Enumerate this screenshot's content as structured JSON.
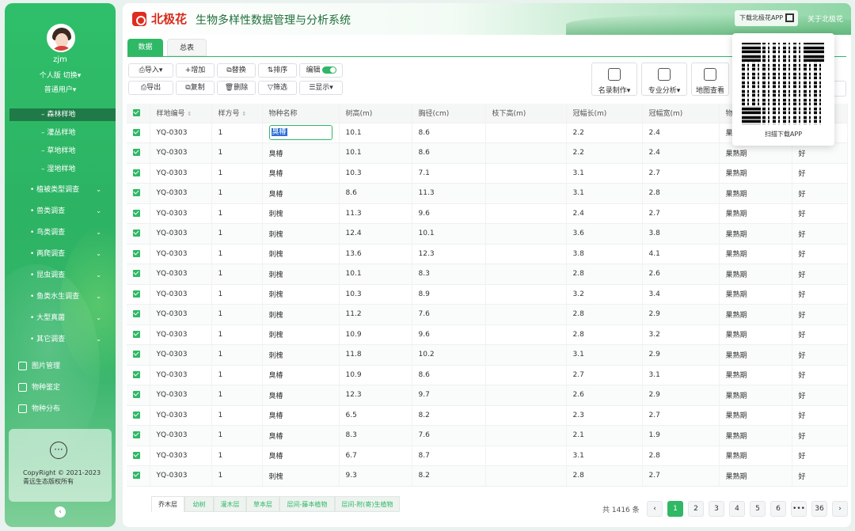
{
  "app": {
    "logo_text": "北极花",
    "title": "生物多样性数据管理与分析系统",
    "download_app": "下载北极花APP",
    "about": "关于北极花"
  },
  "user": {
    "name": "zjm",
    "personal": "个人版",
    "switch": "切换",
    "role": "普通用户"
  },
  "sidebar": {
    "sub_items": [
      {
        "label": "森林样地"
      },
      {
        "label": "灌丛样地"
      },
      {
        "label": "草地样地"
      },
      {
        "label": "湿地样地"
      }
    ],
    "items": [
      {
        "label": "植被类型调查"
      },
      {
        "label": "兽类调查"
      },
      {
        "label": "鸟类调查"
      },
      {
        "label": "两爬调查"
      },
      {
        "label": "昆虫调查"
      },
      {
        "label": "鱼类水生调查"
      },
      {
        "label": "大型真菌"
      },
      {
        "label": "其它调查"
      }
    ],
    "tools": [
      {
        "label": "图片管理"
      },
      {
        "label": "物种鉴定"
      },
      {
        "label": "物种分布"
      }
    ],
    "copyright": "CopyRight © 2021-2023 青远生态版权所有"
  },
  "tabs": [
    {
      "label": "数据"
    },
    {
      "label": "总表"
    }
  ],
  "toolbar": {
    "import": "导入",
    "add": "增加",
    "replace": "替换",
    "sort": "排序",
    "edit": "编辑",
    "export": "导出",
    "copy": "复制",
    "delete": "删除",
    "filter": "筛选",
    "display": "显示",
    "catalog": "名录制作",
    "analysis": "专业分析",
    "map": "地图查看"
  },
  "qr": {
    "label": "扫描下载APP"
  },
  "table": {
    "columns": [
      "样地编号",
      "样方号",
      "物种名称",
      "树高(m)",
      "胸径(cm)",
      "枝下高(m)",
      "冠幅长(m)",
      "冠幅宽(m)",
      "物",
      ""
    ],
    "rows": [
      [
        "YQ-0303",
        "1",
        "臭椿",
        "10.1",
        "8.6",
        "",
        "2.2",
        "2.4",
        "果熟期",
        "好"
      ],
      [
        "YQ-0303",
        "1",
        "臭椿",
        "10.1",
        "8.6",
        "",
        "2.2",
        "2.4",
        "果熟期",
        "好"
      ],
      [
        "YQ-0303",
        "1",
        "臭椿",
        "10.3",
        "7.1",
        "",
        "3.1",
        "2.7",
        "果熟期",
        "好"
      ],
      [
        "YQ-0303",
        "1",
        "臭椿",
        "8.6",
        "11.3",
        "",
        "3.1",
        "2.8",
        "果熟期",
        "好"
      ],
      [
        "YQ-0303",
        "1",
        "刺槐",
        "11.3",
        "9.6",
        "",
        "2.4",
        "2.7",
        "果熟期",
        "好"
      ],
      [
        "YQ-0303",
        "1",
        "刺槐",
        "12.4",
        "10.1",
        "",
        "3.6",
        "3.8",
        "果熟期",
        "好"
      ],
      [
        "YQ-0303",
        "1",
        "刺槐",
        "13.6",
        "12.3",
        "",
        "3.8",
        "4.1",
        "果熟期",
        "好"
      ],
      [
        "YQ-0303",
        "1",
        "刺槐",
        "10.1",
        "8.3",
        "",
        "2.8",
        "2.6",
        "果熟期",
        "好"
      ],
      [
        "YQ-0303",
        "1",
        "刺槐",
        "10.3",
        "8.9",
        "",
        "3.2",
        "3.4",
        "果熟期",
        "好"
      ],
      [
        "YQ-0303",
        "1",
        "刺槐",
        "11.2",
        "7.6",
        "",
        "2.8",
        "2.9",
        "果熟期",
        "好"
      ],
      [
        "YQ-0303",
        "1",
        "刺槐",
        "10.9",
        "9.6",
        "",
        "2.8",
        "3.2",
        "果熟期",
        "好"
      ],
      [
        "YQ-0303",
        "1",
        "刺槐",
        "11.8",
        "10.2",
        "",
        "3.1",
        "2.9",
        "果熟期",
        "好"
      ],
      [
        "YQ-0303",
        "1",
        "臭椿",
        "10.9",
        "8.6",
        "",
        "2.7",
        "3.1",
        "果熟期",
        "好"
      ],
      [
        "YQ-0303",
        "1",
        "臭椿",
        "12.3",
        "9.7",
        "",
        "2.6",
        "2.9",
        "果熟期",
        "好"
      ],
      [
        "YQ-0303",
        "1",
        "臭椿",
        "6.5",
        "8.2",
        "",
        "2.3",
        "2.7",
        "果熟期",
        "好"
      ],
      [
        "YQ-0303",
        "1",
        "臭椿",
        "8.3",
        "7.6",
        "",
        "2.1",
        "1.9",
        "果熟期",
        "好"
      ],
      [
        "YQ-0303",
        "1",
        "臭椿",
        "6.7",
        "8.7",
        "",
        "3.1",
        "2.8",
        "果熟期",
        "好"
      ],
      [
        "YQ-0303",
        "1",
        "刺槐",
        "9.3",
        "8.2",
        "",
        "2.8",
        "2.7",
        "果熟期",
        "好"
      ]
    ]
  },
  "bottom_tabs": [
    {
      "label": "乔木层"
    },
    {
      "label": "幼树"
    },
    {
      "label": "灌木层"
    },
    {
      "label": "草本层"
    },
    {
      "label": "层间-藤本植物"
    },
    {
      "label": "层间-附(寄)生植物"
    }
  ],
  "pagination": {
    "total": "共 1416 条",
    "prev": "‹",
    "pages": [
      "1",
      "2",
      "3",
      "4",
      "5",
      "6",
      "•••",
      "36"
    ],
    "next": "›"
  },
  "colors": {
    "accent": "#2fb865",
    "sidebar": "#2cb363",
    "logo": "#d82a1c"
  }
}
